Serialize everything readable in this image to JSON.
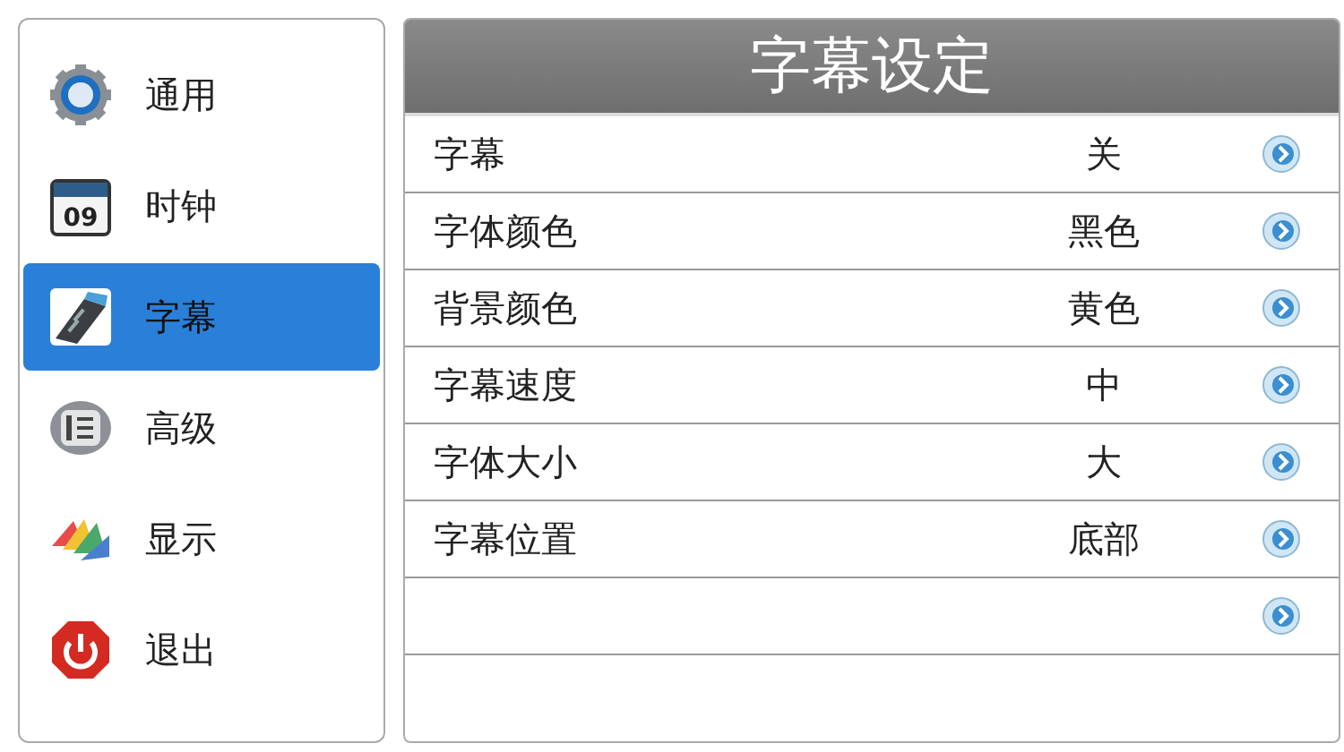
{
  "sidebar": {
    "items": [
      {
        "kind": "gear",
        "label": "通用",
        "selected": false
      },
      {
        "kind": "calendar",
        "icon_text": "09",
        "label": "时钟",
        "selected": false
      },
      {
        "kind": "film",
        "label": "字幕",
        "selected": true
      },
      {
        "kind": "panel",
        "label": "高级",
        "selected": false
      },
      {
        "kind": "swatch",
        "label": "显示",
        "selected": false
      },
      {
        "kind": "power",
        "label": "退出",
        "selected": false
      }
    ]
  },
  "panel": {
    "title": "字幕设定",
    "rows": [
      {
        "label": "字幕",
        "value": "关",
        "arrow": true
      },
      {
        "label": "字体颜色",
        "value": "黑色",
        "arrow": true
      },
      {
        "label": "背景颜色",
        "value": "黄色",
        "arrow": true
      },
      {
        "label": "字幕速度",
        "value": "中",
        "arrow": true
      },
      {
        "label": "字体大小",
        "value": "大",
        "arrow": true
      },
      {
        "label": "字幕位置",
        "value": "底部",
        "arrow": true
      },
      {
        "arrow": true
      }
    ]
  }
}
